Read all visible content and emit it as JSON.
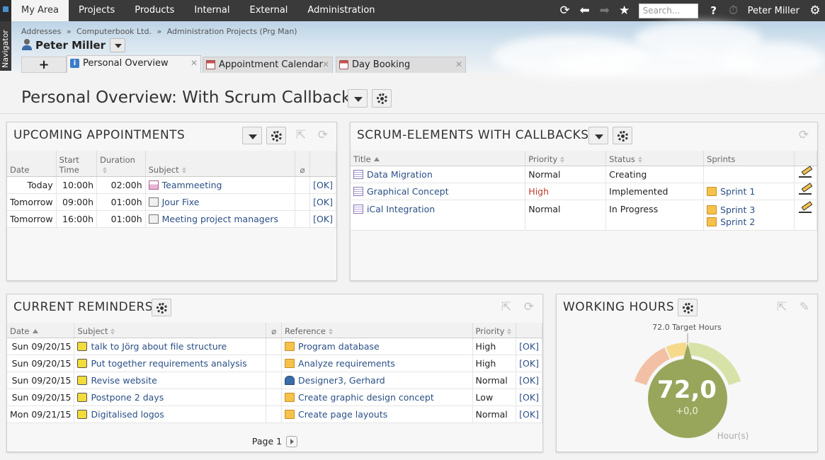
{
  "menu": [
    "My Area",
    "Projects",
    "Products",
    "Internal",
    "External",
    "Administration"
  ],
  "toolbar": {
    "search_placeholder": "Search...",
    "help": "?",
    "user": "Peter Miller"
  },
  "sidebar": {
    "label": "Navigator"
  },
  "breadcrumb": [
    "Addresses",
    "»",
    "Computerbook Ltd.",
    "»",
    "Administration Projects (Prg Man)"
  ],
  "person": {
    "name": "Peter Miller"
  },
  "tabs": [
    {
      "label": "Personal Overview"
    },
    {
      "label": "Appointment Calendar"
    },
    {
      "label": "Day Booking"
    }
  ],
  "page": {
    "title": "Personal Overview: With Scrum Callbacks"
  },
  "appointments": {
    "title": "UPCOMING APPOINTMENTS",
    "headers": {
      "date": "Date",
      "start": "Start Time",
      "duration": "Duration",
      "subject": "Subject"
    },
    "rows": [
      {
        "date": "Today",
        "start": "10:00h",
        "duration": "02:00h",
        "subject": "Teammeeting",
        "ok": "[OK]"
      },
      {
        "date": "Tomorrow",
        "start": "09:00h",
        "duration": "01:00h",
        "subject": "Jour Fixe",
        "ok": "[OK]"
      },
      {
        "date": "Tomorrow",
        "start": "16:00h",
        "duration": "01:00h",
        "subject": "Meeting project managers",
        "ok": "[OK]"
      }
    ]
  },
  "scrum": {
    "title": "SCRUM-ELEMENTS WITH CALLBACKS",
    "headers": {
      "title": "Title",
      "priority": "Priority",
      "status": "Status",
      "sprints": "Sprints"
    },
    "rows": [
      {
        "title": "Data Migration",
        "priority": "Normal",
        "status": "Creating",
        "sprint1": "",
        "sprint2": ""
      },
      {
        "title": "Graphical Concept",
        "priority": "High",
        "status": "Implemented",
        "sprint1": "Sprint 1",
        "sprint2": ""
      },
      {
        "title": "iCal Integration",
        "priority": "Normal",
        "status": "In Progress",
        "sprint1": "Sprint 3",
        "sprint2": "Sprint 2"
      }
    ]
  },
  "reminders": {
    "title": "CURRENT REMINDERS",
    "headers": {
      "date": "Date",
      "subject": "Subject",
      "reference": "Reference",
      "priority": "Priority"
    },
    "rows": [
      {
        "date": "Sun 09/20/15",
        "subject": "talk to Jörg about file structure",
        "reference": "Program database",
        "ref_type": "folder",
        "priority": "High",
        "ok": "[OK]"
      },
      {
        "date": "Sun 09/20/15",
        "subject": "Put together requirements analysis",
        "reference": "Analyze requirements",
        "ref_type": "folder",
        "priority": "High",
        "ok": "[OK]"
      },
      {
        "date": "Sun 09/20/15",
        "subject": "Revise website",
        "reference": "Designer3, Gerhard",
        "ref_type": "user",
        "priority": "Normal",
        "ok": "[OK]"
      },
      {
        "date": "Sun 09/20/15",
        "subject": "Postpone 2 days",
        "reference": "Create graphic design concept",
        "ref_type": "folder",
        "priority": "Low",
        "ok": "[OK]"
      },
      {
        "date": "Mon 09/21/15",
        "subject": "Digitalised logos",
        "reference": "Create page layouts",
        "ref_type": "folder",
        "priority": "Normal",
        "ok": "[OK]"
      }
    ],
    "pager": "Page 1"
  },
  "working_hours": {
    "title": "WORKING HOURS",
    "target_label": "72.0 Target Hours",
    "value": "72,0",
    "delta": "+0,0",
    "unit": "Hour(s)",
    "value_fraction": 0.5,
    "colors": {
      "low": "#f2c0a4",
      "mid": "#f7d98c",
      "high": "#d7e2a8",
      "dial": "#98a65c"
    }
  }
}
